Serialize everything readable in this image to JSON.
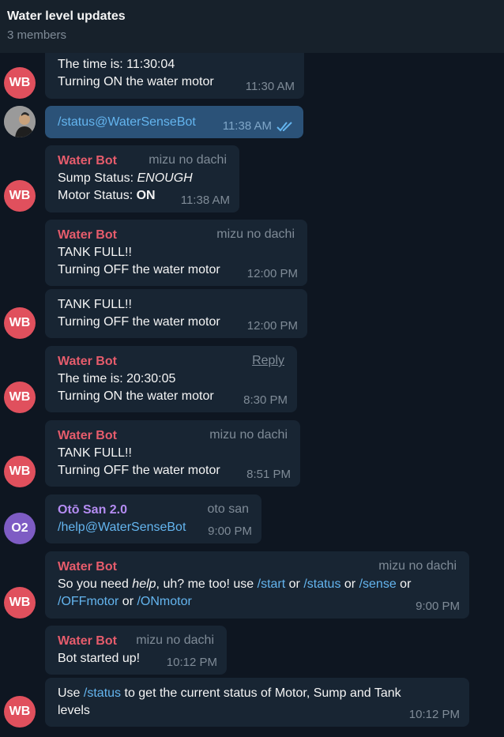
{
  "header": {
    "title": "Water level updates",
    "subtitle": "3 members"
  },
  "colors": {
    "background": "#0e1621",
    "bubble": "#182533",
    "outgoing_bubble": "#2b5278",
    "bot_name": "#e65c6c",
    "user_name": "#b48cf2",
    "link": "#64b5ef",
    "wb_avatar": "#e0505d",
    "o2_avatar": "#7e5cc4"
  },
  "messages": {
    "m1": {
      "avatar": "WB",
      "line1": "The time is: 11:30:04",
      "line2": "Turning ON the water motor",
      "time": "11:30 AM"
    },
    "m2": {
      "text": "/status@WaterSenseBot",
      "time": "11:38 AM",
      "status": "read"
    },
    "m3": {
      "avatar": "WB",
      "sender": "Water Bot",
      "via": "mizu no dachi",
      "line1_label": "Sump Status: ",
      "line1_value": "ENOUGH",
      "line2_label": "Motor Status: ",
      "line2_value": "ON",
      "time": "11:38 AM"
    },
    "m4": {
      "sender": "Water Bot",
      "via": "mizu no dachi",
      "line1": "TANK FULL!!",
      "line2": "Turning OFF the water motor",
      "time": "12:00 PM"
    },
    "m5": {
      "avatar": "WB",
      "line1": "TANK FULL!!",
      "line2": "Turning OFF the water motor",
      "time": "12:00 PM"
    },
    "m6": {
      "avatar": "WB",
      "sender": "Water Bot",
      "reply": "Reply",
      "line1": "The time is: 20:30:05",
      "line2": "Turning ON the water motor",
      "time": "8:30 PM"
    },
    "m7": {
      "avatar": "WB",
      "sender": "Water Bot",
      "via": "mizu no dachi",
      "line1": "TANK FULL!!",
      "line2": "Turning OFF the water motor",
      "time": "8:51 PM"
    },
    "m8": {
      "avatar": "O2",
      "sender": "Otō San 2.0",
      "via": "oto san",
      "text": "/help@WaterSenseBot",
      "time": "9:00 PM"
    },
    "m9": {
      "avatar": "WB",
      "sender": "Water Bot",
      "via": "mizu no dachi",
      "t1": "So you need ",
      "t2": "help",
      "t3": ", uh? me too! use ",
      "c1": "/start",
      "t4": " or ",
      "c2": "/status",
      "t5": " or ",
      "c3": "/sense",
      "t6": " or",
      "c4": "/OFFmotor",
      "t7": " or ",
      "c5": "/ONmotor",
      "time": "9:00 PM"
    },
    "m10": {
      "sender": "Water Bot",
      "via": "mizu no dachi",
      "text": "Bot started up!",
      "time": "10:12 PM"
    },
    "m11": {
      "avatar": "WB",
      "t1": "Use ",
      "c1": "/status",
      "t2": " to get the current status of Motor, Sump and Tank",
      "t3": "levels",
      "time": "10:12 PM"
    }
  }
}
